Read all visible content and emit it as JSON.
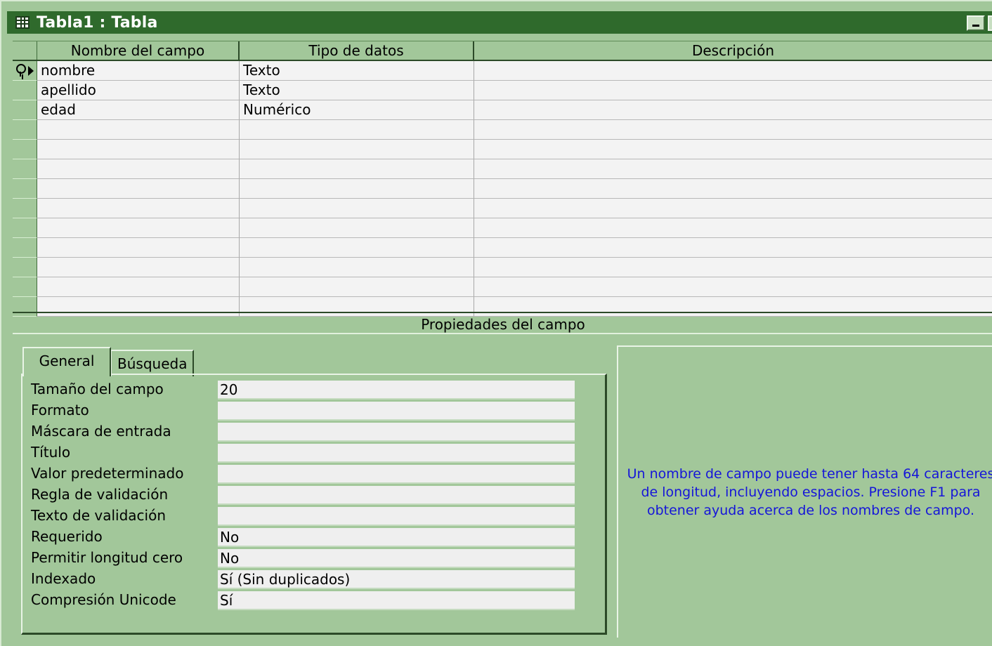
{
  "window": {
    "title": "Tabla1 : Tabla"
  },
  "grid": {
    "headers": {
      "field_name": "Nombre del campo",
      "data_type": "Tipo de datos",
      "description": "Descripción"
    },
    "rows": [
      {
        "field_name": "nombre",
        "data_type": "Texto",
        "description": "",
        "primary_key": true,
        "current": true
      },
      {
        "field_name": "apellido",
        "data_type": "Texto",
        "description": ""
      },
      {
        "field_name": "edad",
        "data_type": "Numérico",
        "description": ""
      }
    ]
  },
  "properties": {
    "title": "Propiedades del campo",
    "tabs": {
      "general": "General",
      "busqueda": "Búsqueda"
    },
    "items": [
      {
        "label": "Tamaño del campo",
        "value": "20"
      },
      {
        "label": "Formato",
        "value": ""
      },
      {
        "label": "Máscara de entrada",
        "value": ""
      },
      {
        "label": "Título",
        "value": ""
      },
      {
        "label": "Valor predeterminado",
        "value": ""
      },
      {
        "label": "Regla de validación",
        "value": ""
      },
      {
        "label": "Texto de validación",
        "value": ""
      },
      {
        "label": "Requerido",
        "value": "No"
      },
      {
        "label": "Permitir longitud cero",
        "value": "No"
      },
      {
        "label": "Indexado",
        "value": "Sí (Sin duplicados)"
      },
      {
        "label": "Compresión Unicode",
        "value": "Sí"
      }
    ],
    "help_lines": [
      "Un nombre de campo puede tener hasta 64 caracteres",
      "de longitud, incluyendo espacios. Presione F1 para",
      "obtener ayuda acerca de los nombres de campo."
    ]
  },
  "colors": {
    "background": "#a2c79a",
    "titlebar": "#2f6a2c",
    "help_text": "#1515d9"
  }
}
